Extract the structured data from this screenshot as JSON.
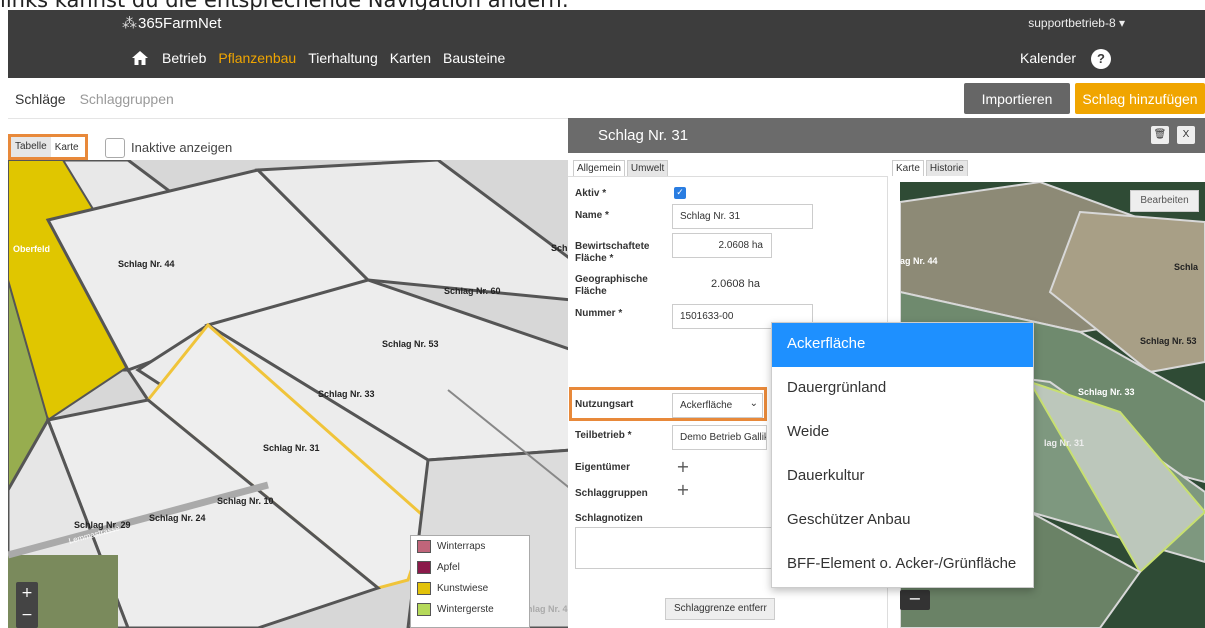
{
  "caption": "links kannst du die entsprechende Navigation ändern:",
  "header": {
    "logo": "365FarmNet",
    "user": "supportbetrieb-8 ▾"
  },
  "nav": {
    "items": [
      "Betrieb",
      "Pflanzenbau",
      "Tierhaltung",
      "Karten",
      "Bausteine"
    ],
    "active": "Pflanzenbau",
    "calendar": "Kalender",
    "help": "?"
  },
  "subnav": {
    "tabs": [
      "Schläge",
      "Schlaggruppen"
    ],
    "selected": "Schläge",
    "import_label": "Importieren",
    "add_label": "Schlag hinzufügen"
  },
  "map_controls": {
    "tabelle": "Tabelle",
    "karte": "Karte",
    "inactive_label": "Inaktive anzeigen"
  },
  "map": {
    "field_labels": [
      "Oberfeld",
      "Schlag Nr. 44",
      "Schl",
      "Schlag Nr. 60",
      "Schlag Nr. 53",
      "Schlag Nr. 33",
      "Schlag Nr. 31",
      "Schlag Nr. 10",
      "Schlag Nr. 24",
      "Schlag Nr. 29",
      "Schlag Nr. 4",
      "Lemmastrasse"
    ],
    "zoom_in": "+",
    "zoom_out": "−"
  },
  "legend": [
    {
      "label": "Winterraps",
      "color": "#c0657a"
    },
    {
      "label": "Apfel",
      "color": "#8b1a4a"
    },
    {
      "label": "Kunstwiese",
      "color": "#e2c20a"
    },
    {
      "label": "Wintergerste",
      "color": "#b5d95a"
    }
  ],
  "detail": {
    "title": "Schlag Nr. 31",
    "trash_icon": "trash-icon",
    "close": "X",
    "tabs": [
      "Allgemein",
      "Umwelt"
    ],
    "form": {
      "aktiv_label": "Aktiv *",
      "aktiv_checked": "✓",
      "name_label": "Name *",
      "name_value": "Schlag Nr. 31",
      "bew_label": "Bewirtschaftete Fläche *",
      "bew_value": "2.0608 ha",
      "geo_label": "Geographische Fläche",
      "geo_value": "2.0608 ha",
      "nummer_label": "Nummer *",
      "nummer_value": "1501633-00",
      "nutzung_label": "Nutzungsart",
      "nutzung_value": "Ackerfläche",
      "teil_label": "Teilbetrieb *",
      "teil_value": "Demo Betrieb Gallike",
      "eigentuemer_label": "Eigentümer",
      "gruppen_label": "Schlaggruppen",
      "notizen_label": "Schlagnotizen",
      "plus": "+",
      "grenze_label": "Schlaggrenze entferr"
    },
    "right_tabs": [
      "Karte",
      "Historie"
    ],
    "right_map": {
      "edit_label": "Bearbeiten",
      "labels": [
        "ag Nr. 44",
        "Schla",
        "Schlag Nr. 53",
        "Schlag Nr. 33",
        "lag Nr. 31"
      ],
      "zoom_out": "−"
    }
  },
  "dropdown": {
    "options": [
      "Ackerfläche",
      "Dauergrünland",
      "Weide",
      "Dauerkultur",
      "Geschützer Anbau",
      "BFF-Element o. Acker-/Grünfläche"
    ],
    "highlighted": "Ackerfläche"
  }
}
